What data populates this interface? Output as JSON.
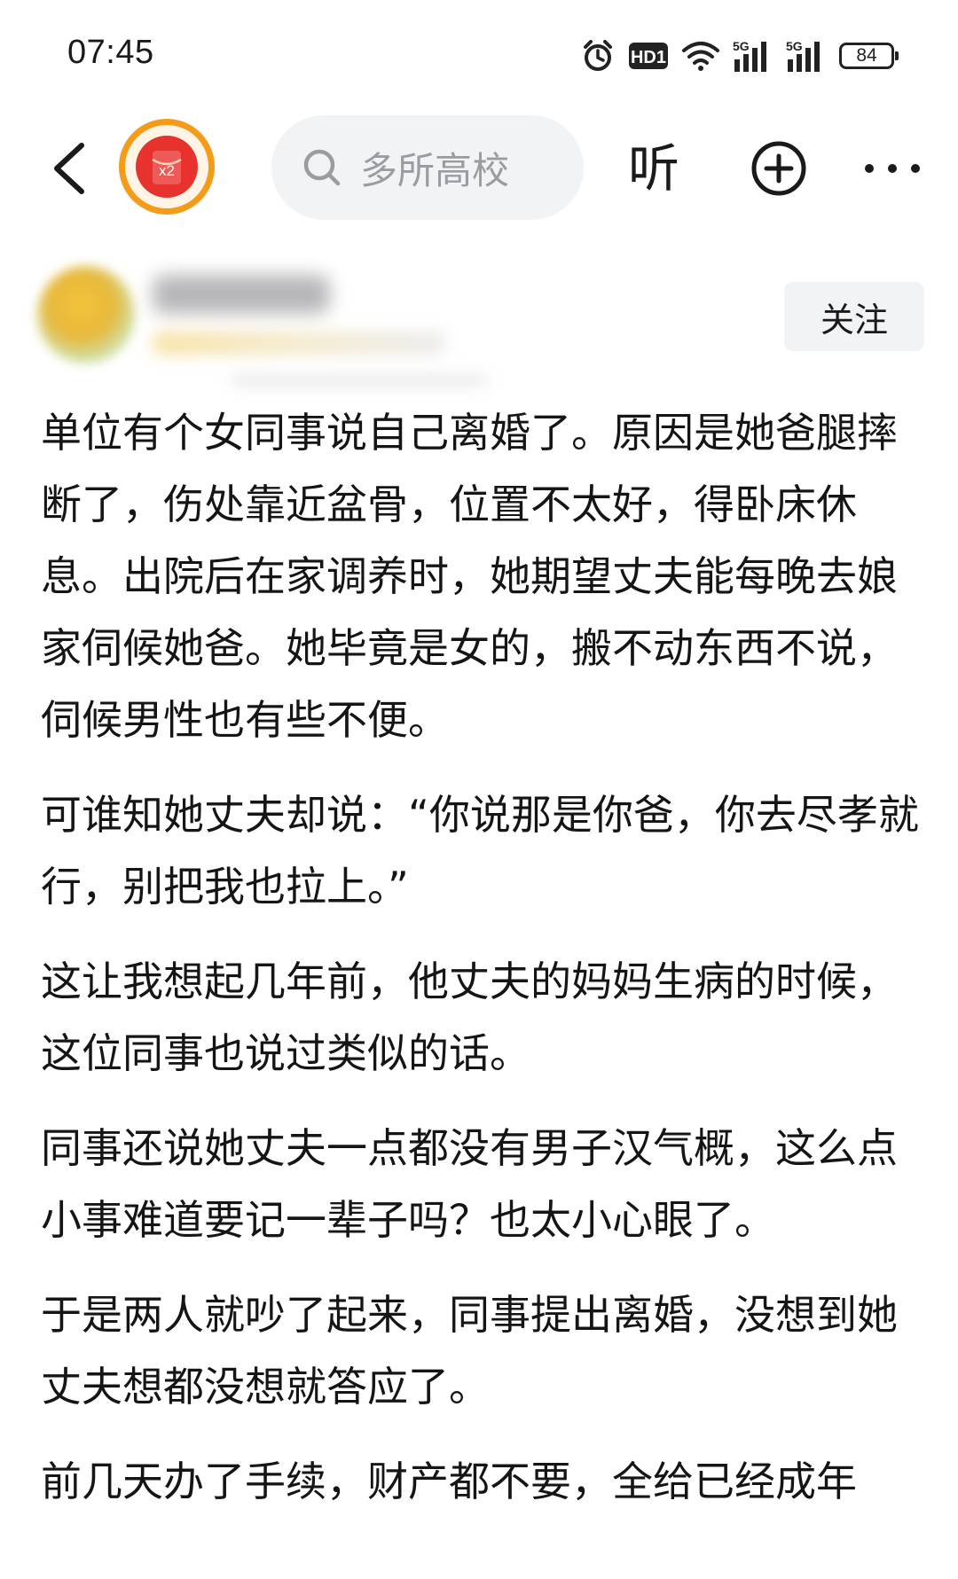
{
  "status_bar": {
    "time": "07:45",
    "hd_label": "HD1",
    "net1": "5G",
    "net2": "5G",
    "battery": "84"
  },
  "nav": {
    "badge_label": "x2",
    "search_placeholder": "多所高校",
    "listen_label": "听"
  },
  "author": {
    "follow_label": "关注"
  },
  "article": {
    "paragraphs": [
      "单位有个女同事说自己离婚了。原因是她爸腿摔断了，伤处靠近盆骨，位置不太好，得卧床休息。出院后在家调养时，她期望丈夫能每晚去娘家伺候她爸。她毕竟是女的，搬不动东西不说，伺候男性也有些不便。",
      "可谁知她丈夫却说：“你说那是你爸，你去尽孝就行，别把我也拉上。”",
      "这让我想起几年前，他丈夫的妈妈生病的时候，这位同事也说过类似的话。",
      "同事还说她丈夫一点都没有男子汉气概，这么点小事难道要记一辈子吗？也太小心眼了。",
      "于是两人就吵了起来，同事提出离婚，没想到她丈夫想都没想就答应了。",
      "前几天办了手续，财产都不要，全给已经成年"
    ]
  },
  "colors": {
    "accent_orange": "#f59b1a",
    "accent_red": "#e8322d",
    "pill_bg": "#f2f3f5",
    "text": "#151515"
  },
  "icons": [
    "alarm-icon",
    "hd-icon",
    "wifi-icon",
    "signal-icon",
    "battery-icon",
    "back-chevron-icon",
    "red-packet-icon",
    "search-icon",
    "add-circle-icon",
    "more-icon"
  ]
}
